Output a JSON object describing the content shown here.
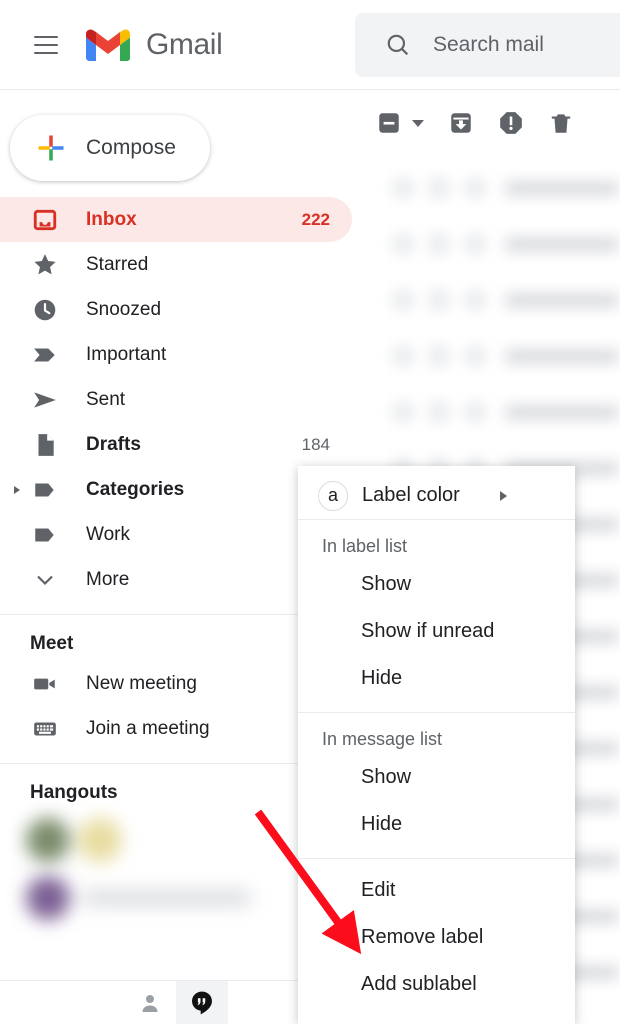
{
  "header": {
    "menu_icon": "hamburger-icon",
    "logo_icon": "gmail-logo-icon",
    "brand": "Gmail",
    "search": {
      "icon": "search-icon",
      "placeholder": "Search mail",
      "value": ""
    }
  },
  "sidebar": {
    "compose": {
      "label": "Compose",
      "icon": "plus-icon"
    },
    "items": [
      {
        "label": "Inbox",
        "icon": "inbox-icon",
        "count": "222",
        "active": true,
        "bold": true,
        "caret": false
      },
      {
        "label": "Starred",
        "icon": "star-icon",
        "count": "",
        "active": false,
        "bold": false,
        "caret": false
      },
      {
        "label": "Snoozed",
        "icon": "clock-icon",
        "count": "",
        "active": false,
        "bold": false,
        "caret": false
      },
      {
        "label": "Important",
        "icon": "important-icon",
        "count": "",
        "active": false,
        "bold": false,
        "caret": false
      },
      {
        "label": "Sent",
        "icon": "send-icon",
        "count": "",
        "active": false,
        "bold": false,
        "caret": false
      },
      {
        "label": "Drafts",
        "icon": "draft-icon",
        "count": "184",
        "active": false,
        "bold": true,
        "caret": false
      },
      {
        "label": "Categories",
        "icon": "label-icon",
        "count": "",
        "active": false,
        "bold": true,
        "caret": true
      },
      {
        "label": "Work",
        "icon": "label-icon",
        "count": "",
        "active": false,
        "bold": false,
        "caret": false
      },
      {
        "label": "More",
        "icon": "chevron-down-icon",
        "count": "",
        "active": false,
        "bold": false,
        "caret": false
      }
    ],
    "meet": {
      "title": "Meet",
      "items": [
        {
          "label": "New meeting",
          "icon": "video-camera-icon"
        },
        {
          "label": "Join a meeting",
          "icon": "keyboard-icon"
        }
      ]
    },
    "hangouts": {
      "title": "Hangouts"
    }
  },
  "toolbar": {
    "items": [
      {
        "icon": "select-all-checkbox-icon"
      },
      {
        "icon": "archive-icon"
      },
      {
        "icon": "report-spam-icon"
      },
      {
        "icon": "delete-icon"
      }
    ]
  },
  "context_menu": {
    "label_color": {
      "label": "Label color",
      "badge": "a",
      "submenu_icon": "chevron-right-icon"
    },
    "groups": [
      {
        "title": "In label list",
        "options": [
          {
            "label": "Show",
            "checked": true
          },
          {
            "label": "Show if unread",
            "checked": false
          },
          {
            "label": "Hide",
            "checked": false
          }
        ]
      },
      {
        "title": "In message list",
        "options": [
          {
            "label": "Show",
            "checked": true
          },
          {
            "label": "Hide",
            "checked": false
          }
        ]
      }
    ],
    "actions": [
      {
        "label": "Edit"
      },
      {
        "label": "Remove label"
      },
      {
        "label": "Add sublabel"
      }
    ]
  },
  "bottom_bar": {
    "items": [
      {
        "icon": "person-icon",
        "selected": false
      },
      {
        "icon": "hangouts-icon",
        "selected": true
      }
    ]
  },
  "annotation": {
    "arrow_color": "#fc0d1b",
    "points_to": "Remove label"
  },
  "colors": {
    "accent_red": "#d93025",
    "active_pill": "#fce8e6",
    "text_primary": "#202124",
    "text_secondary": "#5f6368",
    "divider": "#e8eaed",
    "search_bg": "#f1f3f4"
  }
}
